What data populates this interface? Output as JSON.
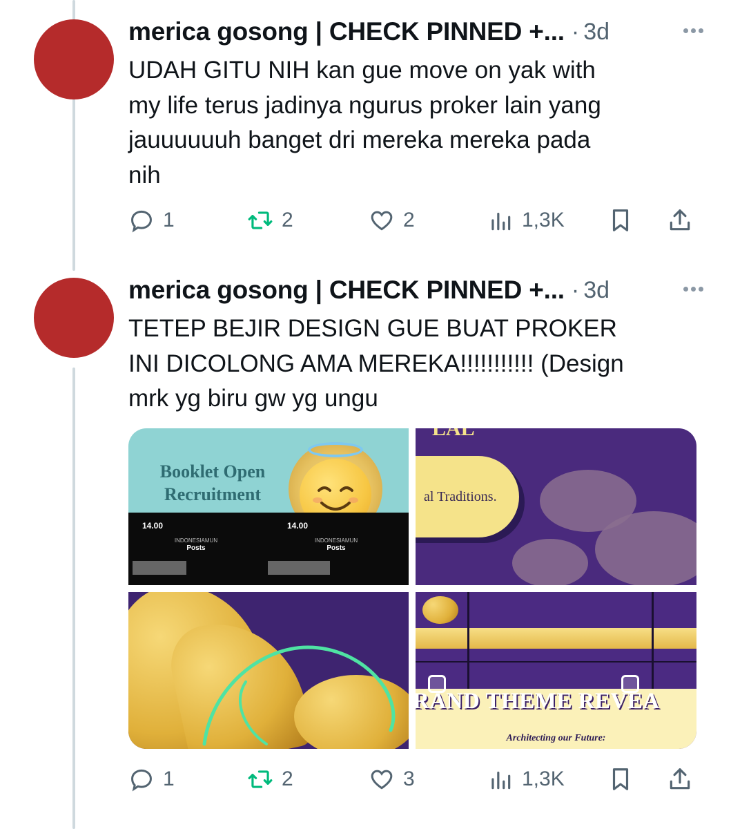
{
  "tweets": [
    {
      "author": "merica gosong | CHECK PINNED +...",
      "time": "3d",
      "text": "UDAH GITU NIH kan gue move on yak with\nmy life terus jadinya ngurus proker lain yang\njauuuuuuh banget dri mereka mereka pada\nnih",
      "replies": "1",
      "retweets": "2",
      "likes": "2",
      "views": "1,3K"
    },
    {
      "author": "merica gosong | CHECK PINNED +...",
      "time": "3d",
      "text": "TETEP BEJIR DESIGN GUE BUAT PROKER\nINI DICOLONG AMA MEREKA!!!!!!!!!!! (Design\nmrk yg biru gw yg ungu",
      "replies": "1",
      "retweets": "2",
      "likes": "3",
      "views": "1,3K",
      "media": {
        "img1": {
          "title": "Booklet Open Recruitment",
          "phone_time_1": "14.00",
          "phone_time_2": "14.00",
          "account": "INDONESIAMUN",
          "posts": "Posts"
        },
        "img2": {
          "header": "LAL",
          "text": "al Traditions."
        },
        "img4": {
          "title": "RAND THEME REVEA",
          "subtitle": "Architecting our Future:"
        }
      }
    }
  ],
  "colors": {
    "avatar": "#b52b2b",
    "retweet": "#00ba7c",
    "secondary_text": "#536471"
  }
}
